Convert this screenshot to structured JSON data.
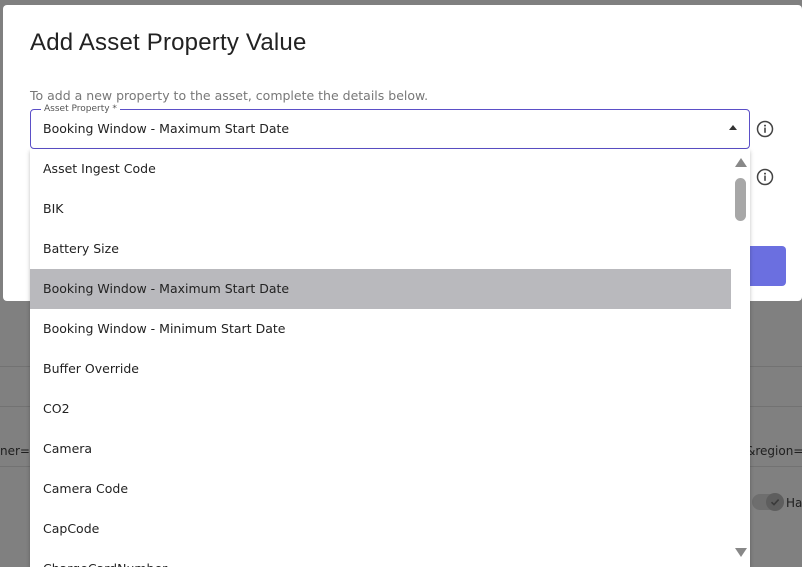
{
  "background": {
    "left_text": "ner=to",
    "right_text": "&region=e",
    "toggle_label": "Ha"
  },
  "modal": {
    "title": "Add Asset Property Value",
    "subtitle": "To add a new property to the asset, complete the details below."
  },
  "field": {
    "label": "Asset Property *",
    "value": "Booking Window - Maximum Start Date"
  },
  "icons": {
    "caret": "caret-up-icon",
    "info": "info-circle-icon"
  },
  "dropdown": {
    "options": [
      "Asset Ingest Code",
      "BIK",
      "Battery Size",
      "Booking Window - Maximum Start Date",
      "Booking Window - Minimum Start Date",
      "Buffer Override",
      "CO2",
      "Camera",
      "Camera Code",
      "CapCode",
      "ChargeCardNumber"
    ],
    "selected": "Booking Window - Maximum Start Date"
  },
  "colors": {
    "accent": "#5b4fc7",
    "primary_button": "#6b6fe0",
    "selected_option": "#b9b9bd"
  }
}
